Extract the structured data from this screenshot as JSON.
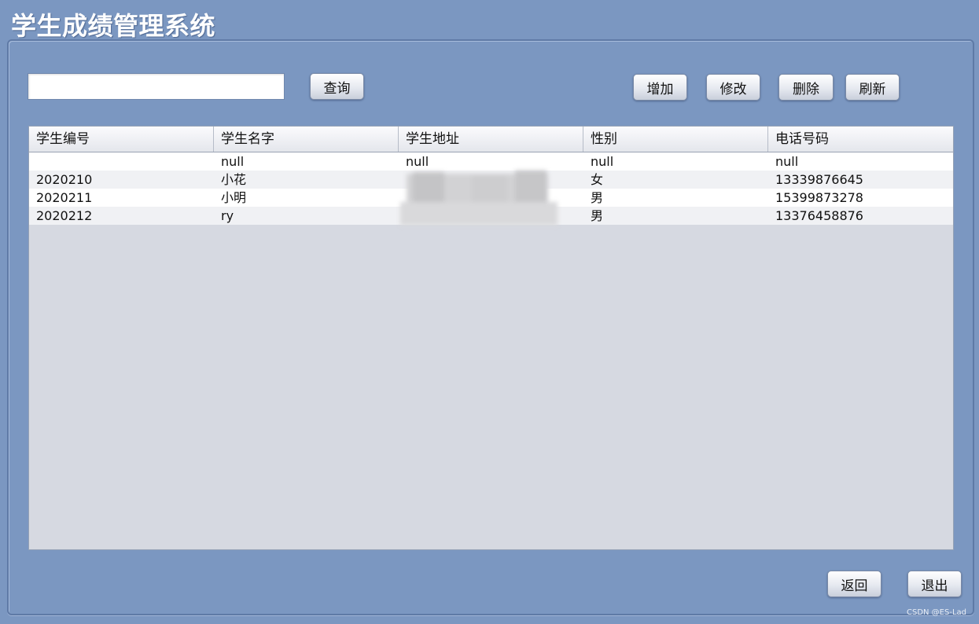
{
  "app": {
    "title": "学生成绩管理系统"
  },
  "search": {
    "value": "",
    "placeholder": ""
  },
  "toolbar": {
    "query_label": "查询",
    "add_label": "增加",
    "edit_label": "修改",
    "delete_label": "删除",
    "refresh_label": "刷新"
  },
  "table": {
    "columns": [
      "学生编号",
      "学生名字",
      "学生地址",
      "性别",
      "电话号码"
    ],
    "rows": [
      [
        "",
        "null",
        "null",
        "null",
        "null"
      ],
      [
        "2020210",
        "小花",
        "",
        "女",
        "13339876645"
      ],
      [
        "2020211",
        "小明",
        "",
        "男",
        "15399873278"
      ],
      [
        "2020212",
        "ry",
        "",
        "男",
        "13376458876"
      ]
    ]
  },
  "footer": {
    "back_label": "返回",
    "exit_label": "退出",
    "watermark": "CSDN @ES-Lad"
  },
  "colors": {
    "window_bg": "#7b97c1",
    "grid_bg": "#d6d9e1",
    "row_even": "#ffffff",
    "row_odd": "#f0f1f4"
  }
}
